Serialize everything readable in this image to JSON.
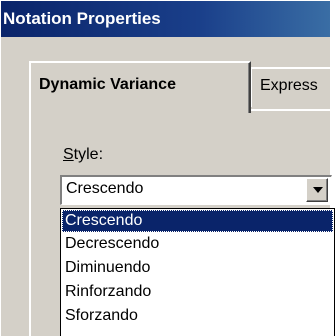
{
  "window": {
    "title": "Notation Properties"
  },
  "tabs": [
    {
      "label": "Dynamic Variance",
      "active": true
    },
    {
      "label": "Express",
      "active": false
    }
  ],
  "style": {
    "label_mnemonic": "S",
    "label_rest": "tyle:",
    "selected_value": "Crescendo",
    "options": [
      "Crescendo",
      "Decrescendo",
      "Diminuendo",
      "Rinforzando",
      "Sforzando"
    ]
  },
  "colors": {
    "titlebar": "#0a246a",
    "highlight": "#0a246a",
    "face": "#d4d0c8"
  },
  "icons": {
    "combo_button": "chevron-down-icon"
  }
}
